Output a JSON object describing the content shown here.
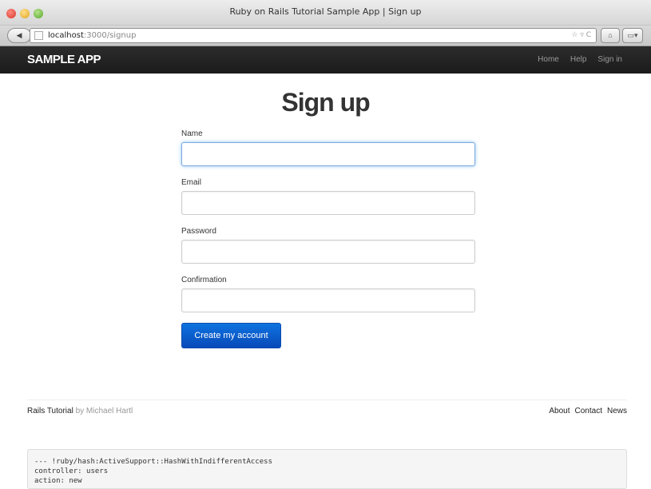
{
  "window": {
    "title": "Ruby on Rails Tutorial Sample App | Sign up"
  },
  "browser": {
    "url_host": "localhost",
    "url_path": ":3000/signup",
    "back_icon": "back-arrow-icon",
    "url_right_icons": "☆ ▿ C",
    "home_icon": "home-icon",
    "sidebar_icon": "sidebar-icon"
  },
  "navbar": {
    "brand": "SAMPLE APP",
    "links": [
      "Home",
      "Help",
      "Sign in"
    ]
  },
  "page": {
    "title": "Sign up"
  },
  "form": {
    "fields": [
      {
        "label": "Name",
        "value": ""
      },
      {
        "label": "Email",
        "value": ""
      },
      {
        "label": "Password",
        "value": ""
      },
      {
        "label": "Confirmation",
        "value": ""
      }
    ],
    "submit_label": "Create my account"
  },
  "footer": {
    "brand": "Rails Tutorial",
    "by": "by Michael Hartl",
    "links": [
      "About",
      "Contact",
      "News"
    ]
  },
  "debug": {
    "lines": [
      "--- !ruby/hash:ActiveSupport::HashWithIndifferentAccess",
      "controller: users",
      "action: new"
    ]
  },
  "colors": {
    "primary_button": "#0a5fd0",
    "navbar": "#222222"
  }
}
